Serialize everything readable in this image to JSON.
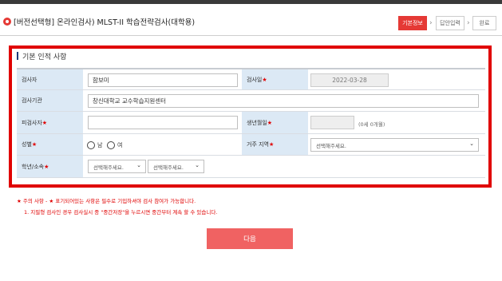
{
  "header": {
    "title": "[버전선택형]  온라인검사) MLST-II 학습전략검사(대학용)",
    "steps": [
      {
        "label": "기본정보",
        "active": true
      },
      {
        "label": "답안입력",
        "active": false
      },
      {
        "label": "완료",
        "active": false
      }
    ],
    "arrow": "›"
  },
  "section": {
    "title": "기본 인적 사항"
  },
  "form": {
    "examiner_label": "검사자",
    "examiner_value": "함보미",
    "exam_date_label": "검사일",
    "exam_date_value": "2022-03-28",
    "institution_label": "검사기관",
    "institution_value": "창신대학교 교수학습지원센터",
    "examinee_label": "피검사자",
    "examinee_value": "",
    "birth_label": "생년월일",
    "birth_value": "",
    "age_display": "(0세 0개월)",
    "gender_label": "성별",
    "gender_options": [
      "남",
      "여"
    ],
    "region_label": "거주 지역",
    "region_select": "선택해주세요.",
    "grade_label": "학년/소속",
    "grade_select_1": "선택해주세요.",
    "grade_select_2": "선택해주세요.",
    "required_mark": "★"
  },
  "notices": {
    "line1": "★ 주의 사항 - ★ 표기되어있는 사항은 필수로 기입하셔야 검사 참여가 가능합니다.",
    "line2": "1. 지필형 검사인 경우 검사실시 중 \"중간저장\"을 누르시면 중간부터 계속 할 수 있습니다."
  },
  "actions": {
    "next_label": "다음"
  },
  "colors": {
    "accent": "#e53935",
    "frame": "#e00000",
    "label_bg": "#dce9f5",
    "button": "#f06262"
  }
}
